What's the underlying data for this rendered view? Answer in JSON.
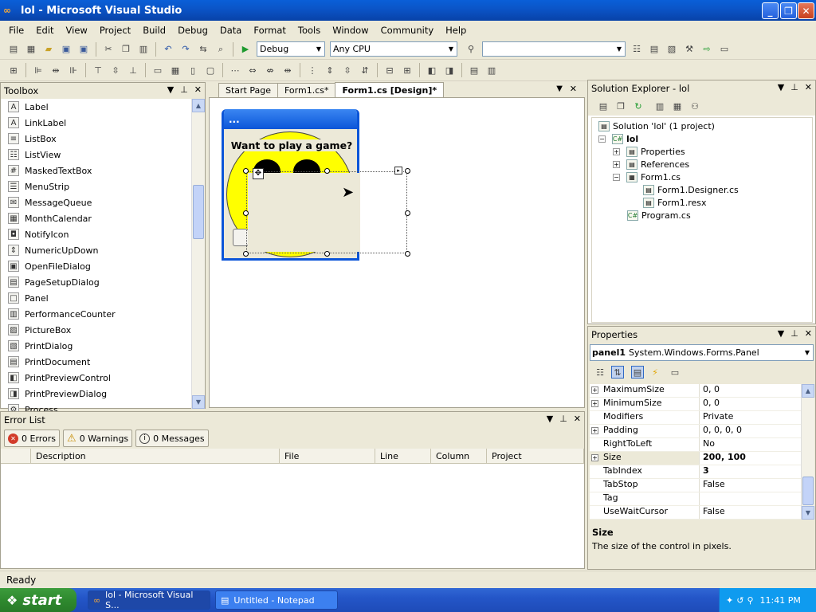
{
  "window": {
    "title": "lol - Microsoft Visual Studio",
    "minimize": "_",
    "maximize": "❐",
    "close": "✕"
  },
  "menu": [
    "File",
    "Edit",
    "View",
    "Project",
    "Build",
    "Debug",
    "Data",
    "Format",
    "Tools",
    "Window",
    "Community",
    "Help"
  ],
  "toolbar": {
    "config": "Debug",
    "platform": "Any CPU",
    "find": ""
  },
  "toolbox": {
    "title": "Toolbox",
    "items": [
      {
        "label": "Label",
        "icon": "A"
      },
      {
        "label": "LinkLabel",
        "icon": "A"
      },
      {
        "label": "ListBox",
        "icon": "≡"
      },
      {
        "label": "ListView",
        "icon": "☷"
      },
      {
        "label": "MaskedTextBox",
        "icon": "#"
      },
      {
        "label": "MenuStrip",
        "icon": "☰"
      },
      {
        "label": "MessageQueue",
        "icon": "✉"
      },
      {
        "label": "MonthCalendar",
        "icon": "▦"
      },
      {
        "label": "NotifyIcon",
        "icon": "◘"
      },
      {
        "label": "NumericUpDown",
        "icon": "⇕"
      },
      {
        "label": "OpenFileDialog",
        "icon": "▣"
      },
      {
        "label": "PageSetupDialog",
        "icon": "▤"
      },
      {
        "label": "Panel",
        "icon": "□"
      },
      {
        "label": "PerformanceCounter",
        "icon": "▥"
      },
      {
        "label": "PictureBox",
        "icon": "▨"
      },
      {
        "label": "PrintDialog",
        "icon": "▧"
      },
      {
        "label": "PrintDocument",
        "icon": "▤"
      },
      {
        "label": "PrintPreviewControl",
        "icon": "◧"
      },
      {
        "label": "PrintPreviewDialog",
        "icon": "◨"
      },
      {
        "label": "Process",
        "icon": "⚙"
      }
    ]
  },
  "tabs": [
    {
      "label": "Start Page",
      "active": false
    },
    {
      "label": "Form1.cs*",
      "active": false
    },
    {
      "label": "Form1.cs [Design]*",
      "active": true
    }
  ],
  "form": {
    "title": "...",
    "heading": "Want to play a game?"
  },
  "errorlist": {
    "title": "Error List",
    "errors": "0 Errors",
    "warnings": "0 Warnings",
    "messages": "0 Messages",
    "columns": [
      "",
      "Description",
      "File",
      "Line",
      "Column",
      "Project"
    ]
  },
  "solution": {
    "title": "Solution Explorer - lol",
    "tree": [
      {
        "label": "Solution 'lol' (1 project)",
        "level": 0,
        "bold": false
      },
      {
        "label": "lol",
        "level": 1,
        "bold": true
      },
      {
        "label": "Properties",
        "level": 2,
        "bold": false
      },
      {
        "label": "References",
        "level": 2,
        "bold": false
      },
      {
        "label": "Form1.cs",
        "level": 2,
        "bold": false
      },
      {
        "label": "Form1.Designer.cs",
        "level": 3,
        "bold": false
      },
      {
        "label": "Form1.resx",
        "level": 3,
        "bold": false
      },
      {
        "label": "Program.cs",
        "level": 2,
        "bold": false
      }
    ]
  },
  "properties": {
    "title": "Properties",
    "object": "panel1",
    "type": "System.Windows.Forms.Panel",
    "rows": [
      {
        "name": "MaximumSize",
        "value": "0, 0",
        "expand": true,
        "bold": false
      },
      {
        "name": "MinimumSize",
        "value": "0, 0",
        "expand": true,
        "bold": false
      },
      {
        "name": "Modifiers",
        "value": "Private",
        "expand": false,
        "bold": false
      },
      {
        "name": "Padding",
        "value": "0, 0, 0, 0",
        "expand": true,
        "bold": false
      },
      {
        "name": "RightToLeft",
        "value": "No",
        "expand": false,
        "bold": false
      },
      {
        "name": "Size",
        "value": "200, 100",
        "expand": true,
        "bold": true
      },
      {
        "name": "TabIndex",
        "value": "3",
        "expand": false,
        "bold": true
      },
      {
        "name": "TabStop",
        "value": "False",
        "expand": false,
        "bold": false
      },
      {
        "name": "Tag",
        "value": "",
        "expand": false,
        "bold": false
      },
      {
        "name": "UseWaitCursor",
        "value": "False",
        "expand": false,
        "bold": false
      }
    ],
    "desc_title": "Size",
    "desc_text": "The size of the control in pixels."
  },
  "status": "Ready",
  "taskbar": {
    "start": "start",
    "items": [
      {
        "label": "lol - Microsoft Visual S...",
        "active": true
      },
      {
        "label": "Untitled - Notepad",
        "active": false
      }
    ],
    "clock": "11:41 PM"
  }
}
